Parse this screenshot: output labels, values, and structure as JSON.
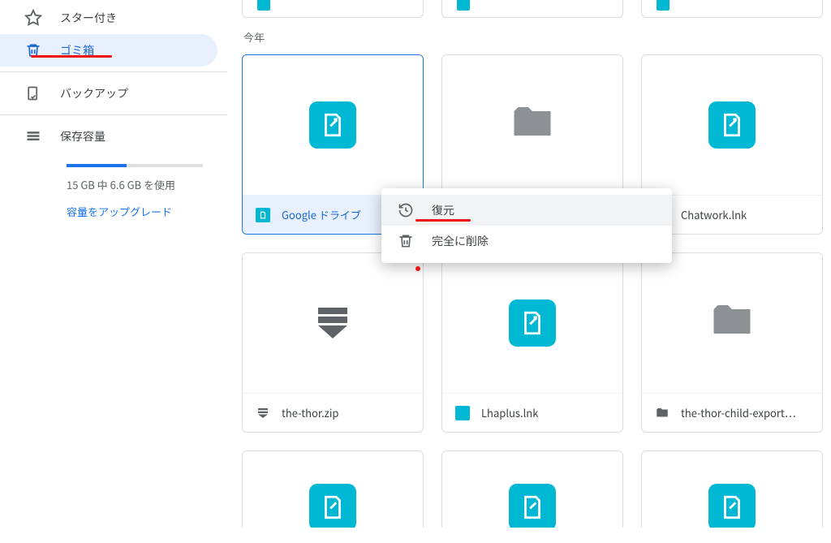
{
  "sidebar": {
    "items": [
      {
        "label": "スター付き"
      },
      {
        "label": "ゴミ箱"
      },
      {
        "label": "バックアップ"
      },
      {
        "label": "保存容量"
      }
    ],
    "storage_text": "15 GB 中 6.6 GB を使用",
    "upgrade_label": "容量をアップグレード"
  },
  "main": {
    "section_label": "今年",
    "files": [
      {
        "name": "Google ドライブ",
        "type": "lnk"
      },
      {
        "name": "",
        "type": "folder"
      },
      {
        "name": "Chatwork.lnk",
        "type": "lnk"
      },
      {
        "name": "the-thor.zip",
        "type": "zip"
      },
      {
        "name": "Lhaplus.lnk",
        "type": "lnk"
      },
      {
        "name": "the-thor-child-export…",
        "type": "folder"
      }
    ]
  },
  "context_menu": {
    "restore": "復元",
    "delete_forever": "完全に削除"
  }
}
